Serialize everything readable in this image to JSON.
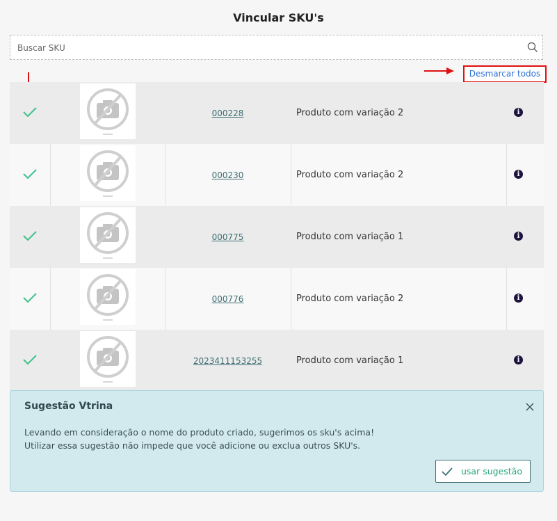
{
  "page_title": "Vincular SKU's",
  "search": {
    "placeholder": "Buscar SKU",
    "value": ""
  },
  "unselect_all_label": "Desmarcar todos",
  "colors": {
    "check": "#3cc18a",
    "annotation": "#e01010",
    "link": "#2b6fd6",
    "info": "#1f1440"
  },
  "rows": [
    {
      "selected": true,
      "sku": "000228",
      "name": "Produto com variação 2"
    },
    {
      "selected": true,
      "sku": "000230",
      "name": "Produto com variação 2"
    },
    {
      "selected": true,
      "sku": "000775",
      "name": "Produto com variação 1"
    },
    {
      "selected": true,
      "sku": "000776",
      "name": "Produto com variação 2"
    },
    {
      "selected": true,
      "sku": "2023411153255",
      "name": "Produto com variação 1"
    }
  ],
  "thumbnail_icon": "no-image-camera-icon",
  "info_icon": "info-icon",
  "suggestion": {
    "title": "Sugestão Vtrina",
    "line1": "Levando em consideração o nome do produto criado, sugerimos os sku's acima!",
    "line2": "Utilizar essa sugestão não impede que você adicione ou exclua outros SKU's.",
    "button_label": "usar sugestão"
  }
}
